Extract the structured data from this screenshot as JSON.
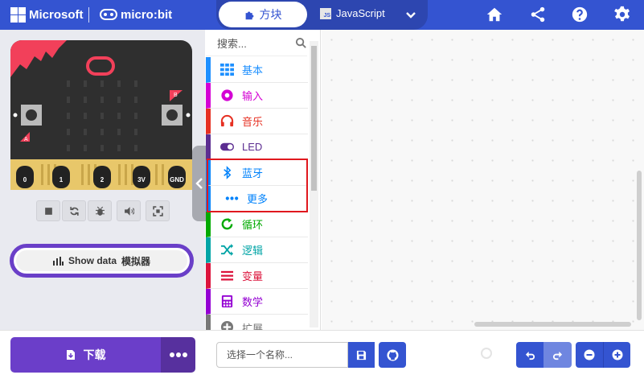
{
  "header": {
    "brand": "Microsoft",
    "product": "micro:bit",
    "tabs": [
      {
        "label": "方块",
        "active": true
      },
      {
        "label": "JavaScript",
        "active": false
      }
    ],
    "icons": [
      "home-icon",
      "share-icon",
      "help-icon",
      "settings-icon"
    ]
  },
  "simulator": {
    "pins": [
      "0",
      "1",
      "2",
      "3V",
      "GND"
    ],
    "button_labels": [
      "A",
      "B"
    ],
    "controls": [
      "stop-icon",
      "restart-icon",
      "debug-icon",
      "sound-icon",
      "fullscreen-icon"
    ],
    "show_data_label": "Show data",
    "show_data_suffix": "模拟器"
  },
  "toolbox": {
    "search_placeholder": "搜索...",
    "categories": [
      {
        "label": "基本",
        "color": "#1e90ff",
        "icon": "grid-icon"
      },
      {
        "label": "输入",
        "color": "#d400d4",
        "icon": "target-icon"
      },
      {
        "label": "音乐",
        "color": "#e63022",
        "icon": "headphones-icon"
      },
      {
        "label": "LED",
        "color": "#5c2d91",
        "icon": "toggle-icon"
      },
      {
        "label": "蓝牙",
        "color": "#0082fb",
        "icon": "bluetooth-icon"
      },
      {
        "label": "更多",
        "color": "#0082fb",
        "icon": "dots-icon"
      },
      {
        "label": "循环",
        "color": "#00aa00",
        "icon": "loop-icon"
      },
      {
        "label": "逻辑",
        "color": "#00a4a6",
        "icon": "shuffle-icon"
      },
      {
        "label": "变量",
        "color": "#dc143c",
        "icon": "lines-icon"
      },
      {
        "label": "数学",
        "color": "#9400d3",
        "icon": "calculator-icon"
      },
      {
        "label": "扩展",
        "color": "#777777",
        "icon": "plus-icon"
      }
    ]
  },
  "footer": {
    "download_label": "下载",
    "project_name_placeholder": "选择一个名称..."
  },
  "colors": {
    "header_bg": "#3454d1",
    "download_bg": "#6b3ec9",
    "highlight_border": "#e0181e"
  }
}
